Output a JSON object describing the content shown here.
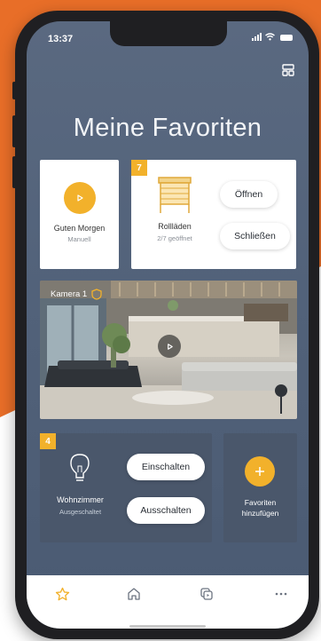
{
  "status": {
    "time": "13:37"
  },
  "title": "Meine Favoriten",
  "scene_card": {
    "name": "Guten Morgen",
    "mode": "Manuell"
  },
  "blinds_card": {
    "badge": "7",
    "name": "Rollläden",
    "status": "2/7 geöffnet",
    "open_label": "Öffnen",
    "close_label": "Schließen"
  },
  "camera_card": {
    "name": "Kamera 1"
  },
  "light_card": {
    "badge": "4",
    "name": "Wohnzimmer",
    "status": "Ausgeschaltet",
    "on_label": "Einschalten",
    "off_label": "Ausschalten"
  },
  "add_card": {
    "line1": "Favoriten",
    "line2": "hinzufügen"
  },
  "tabs": [
    {
      "icon": "star-icon",
      "active": true
    },
    {
      "icon": "home-icon",
      "active": false
    },
    {
      "icon": "devices-icon",
      "active": false
    },
    {
      "icon": "more-icon",
      "active": false
    }
  ],
  "colors": {
    "accent": "#f2b12b",
    "background": "#e86e28",
    "screen": "#52627a"
  }
}
